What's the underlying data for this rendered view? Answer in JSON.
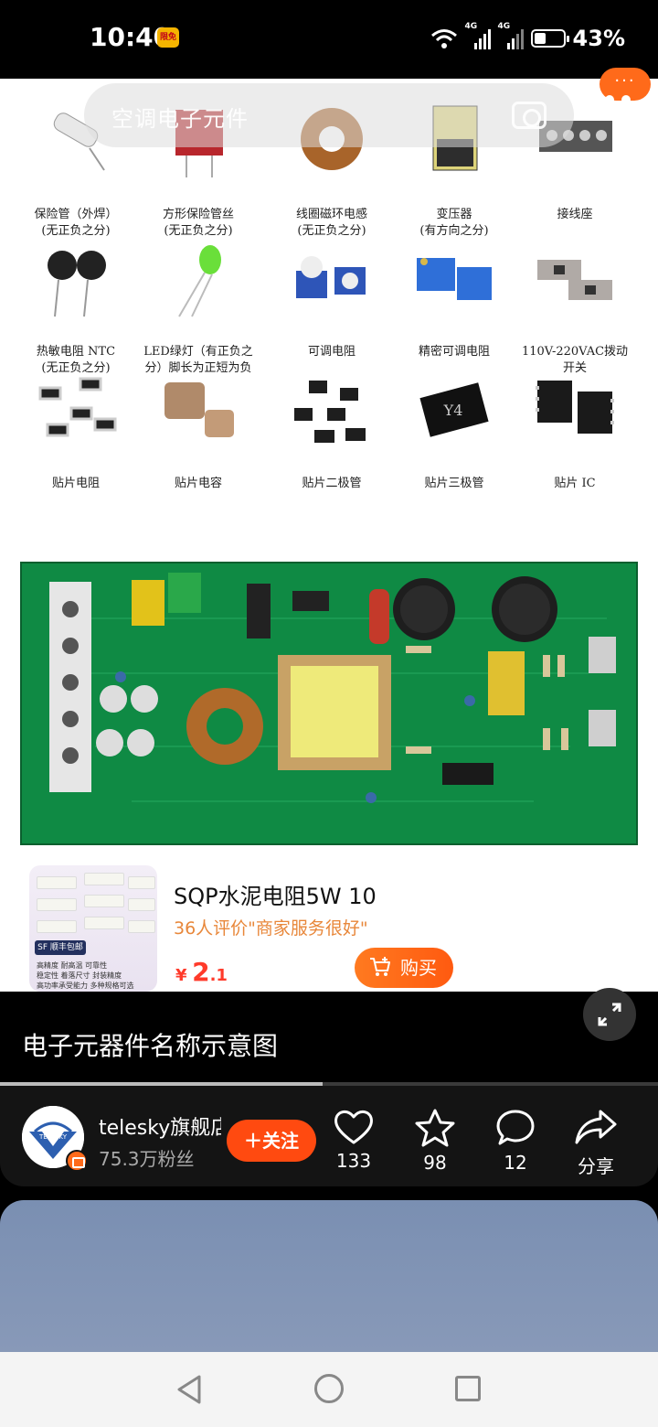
{
  "status_bar": {
    "time": "10:40",
    "badge": "限免",
    "net1": "4G",
    "net2": "4G",
    "battery": "43%",
    "battery_level": 0.43
  },
  "search": {
    "placeholder": "空调电子元件"
  },
  "more_pill": "···",
  "components": [
    {
      "label": "保险管（外焊）\n(无正负之分)",
      "icon": "fuse-tube"
    },
    {
      "label": "方形保险管丝\n(无正负之分)",
      "icon": "square-fuse"
    },
    {
      "label": "线圈磁环电感\n(无正负之分)",
      "icon": "toroid-inductor"
    },
    {
      "label": "变压器\n(有方向之分)",
      "icon": "transformer"
    },
    {
      "label": "接线座",
      "icon": "terminal-block"
    },
    {
      "label": "热敏电阻 NTC\n(无正负之分)",
      "icon": "ntc-thermistor"
    },
    {
      "label": "LED绿灯（有正负之\n分）脚长为正短为负",
      "icon": "green-led"
    },
    {
      "label": "可调电阻",
      "icon": "trimmer-pot"
    },
    {
      "label": "精密可调电阻",
      "icon": "precision-pot"
    },
    {
      "label": "110V-220VAC拨动\n开关",
      "icon": "slide-switch"
    },
    {
      "label": "贴片电阻",
      "icon": "smd-resistor"
    },
    {
      "label": "贴片电容",
      "icon": "smd-capacitor"
    },
    {
      "label": "贴片二极管",
      "icon": "smd-diode"
    },
    {
      "label": "贴片三极管",
      "icon": "smd-transistor"
    },
    {
      "label": "贴片 IC",
      "icon": "smd-ic"
    }
  ],
  "transistor_mark": "Y4",
  "product": {
    "title": "SQP水泥电阻5W 10",
    "reviews": "36人评价\"商家服务很好\"",
    "price_symbol": "¥",
    "price_int": "2",
    "price_dec": ".1",
    "buy_label": "购买",
    "thumb_logo": "SF 顺丰包邮",
    "thumb_lines": "高精度 耐高温 可靠性\n稳定性 着落尺寸 封装精度\n高功率承受能力 多种规格可选"
  },
  "caption": "电子元器件名称示意图",
  "progress": 0.49,
  "creator": {
    "name": "telesky旗舰店",
    "fans": "75.3万粉丝",
    "follow_label": "关注",
    "avatar_text": "TELESKY"
  },
  "actions": {
    "likes": "133",
    "favorites": "98",
    "comments": "12",
    "share": "分享"
  }
}
